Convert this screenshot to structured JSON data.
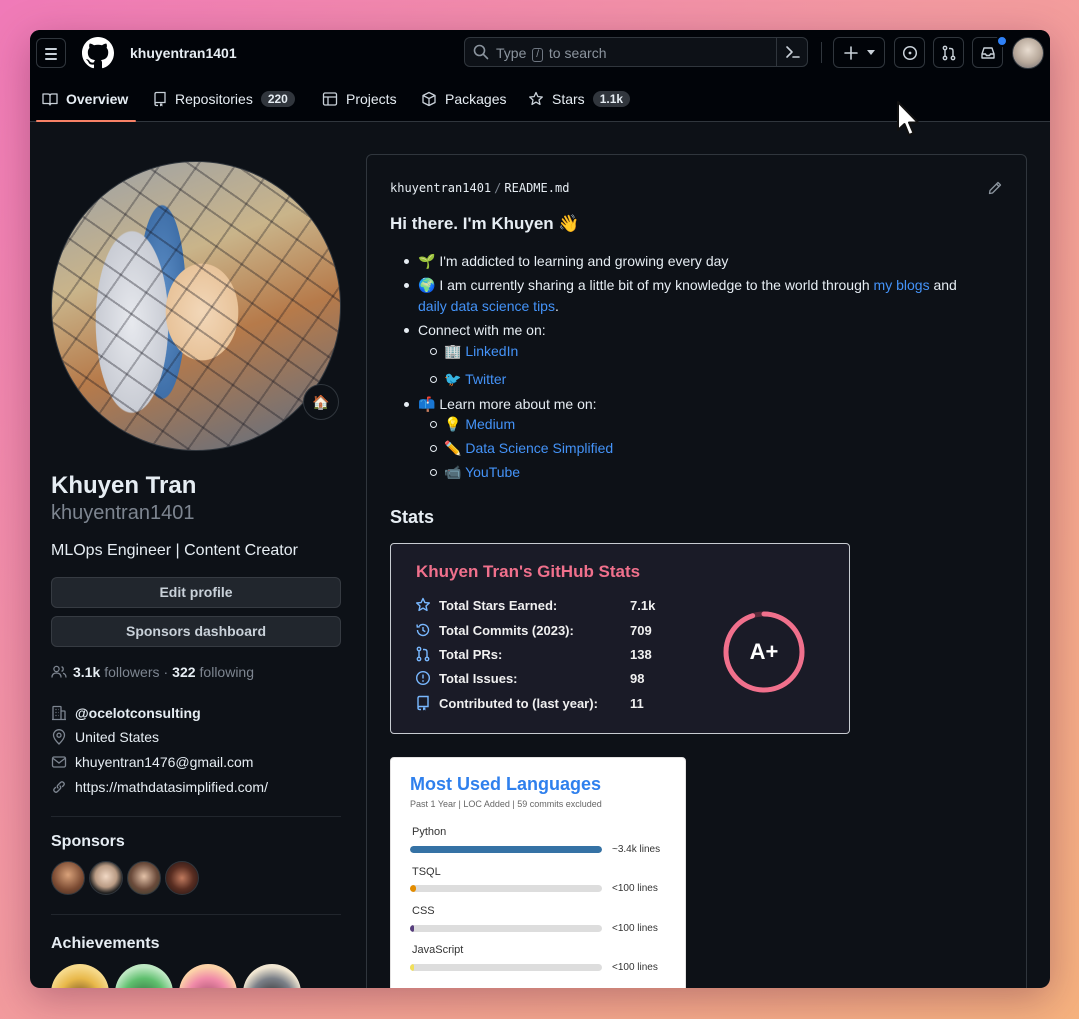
{
  "header": {
    "username": "khuyentran1401",
    "search_placeholder_pre": "Type",
    "search_key": "/",
    "search_placeholder_post": "to search"
  },
  "tabs": [
    {
      "label": "Overview"
    },
    {
      "label": "Repositories",
      "count": "220"
    },
    {
      "label": "Projects"
    },
    {
      "label": "Packages"
    },
    {
      "label": "Stars",
      "count": "1.1k"
    }
  ],
  "profile": {
    "status_emoji": "🏠",
    "name": "Khuyen Tran",
    "login": "khuyentran1401",
    "bio": "MLOps Engineer | Content Creator",
    "edit_button": "Edit profile",
    "sponsors_button": "Sponsors dashboard",
    "followers_count": "3.1k",
    "followers_label": "followers",
    "separator": "·",
    "following_count": "322",
    "following_label": "following",
    "company": "@ocelotconsulting",
    "location": "United States",
    "email": "khuyentran1476@gmail.com",
    "website": "https://mathdatasimplified.com/",
    "sponsors_heading": "Sponsors",
    "achievements_heading": "Achievements"
  },
  "readme": {
    "owner": "khuyentran1401",
    "slash": "/",
    "file": "README.md",
    "title": "Hi there. I'm Khuyen 👋",
    "item1": "🌱 I'm addicted to learning and growing every day",
    "item2_pre": "🌍 I am currently sharing a little bit of my knowledge to the world through ",
    "item2_link1": "my blogs",
    "item2_mid": " and",
    "item2_link2": "daily data science tips",
    "item2_end": ".",
    "item3": "Connect with me on:",
    "linkedin_emoji": "🏢",
    "linkedin": "LinkedIn",
    "twitter_emoji": "🐦",
    "twitter": "Twitter",
    "item4": "📫 Learn more about me on:",
    "medium_emoji": "💡",
    "medium": "Medium",
    "dss_emoji": "✏️",
    "dss": "Data Science Simplified",
    "youtube_emoji": "📹",
    "youtube": "YouTube",
    "stats_heading": "Stats"
  },
  "stats_card": {
    "title": "Khuyen Tran's GitHub Stats",
    "rows": [
      {
        "label": "Total Stars Earned:",
        "value": "7.1k"
      },
      {
        "label": "Total Commits (2023):",
        "value": "709"
      },
      {
        "label": "Total PRs:",
        "value": "138"
      },
      {
        "label": "Total Issues:",
        "value": "98"
      },
      {
        "label": "Contributed to (last year):",
        "value": "11"
      }
    ],
    "grade": "A+",
    "grade_progress": 0.95,
    "accent": "#f0708c"
  },
  "languages_card": {
    "title": "Most Used Languages",
    "subtitle": "Past 1 Year | LOC Added | 59 commits excluded",
    "languages": [
      {
        "name": "Python",
        "amount": "~3.4k lines",
        "fraction": 1.0,
        "color": "#3572a5"
      },
      {
        "name": "TSQL",
        "amount": "<100 lines",
        "fraction": 0.03,
        "color": "#e38c00"
      },
      {
        "name": "CSS",
        "amount": "<100 lines",
        "fraction": 0.02,
        "color": "#563d7c"
      },
      {
        "name": "JavaScript",
        "amount": "<100 lines",
        "fraction": 0.015,
        "color": "#f1e05a"
      }
    ],
    "accent": "#2f80ed"
  }
}
